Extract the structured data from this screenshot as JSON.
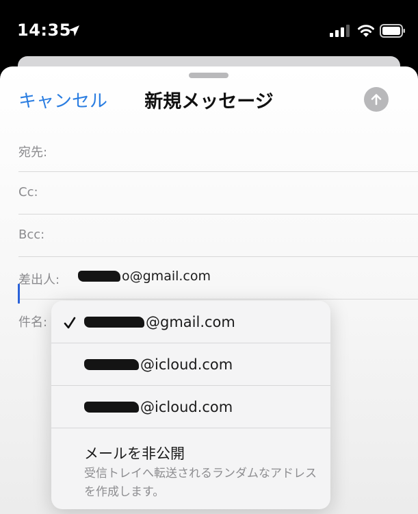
{
  "status_bar": {
    "time": "14:35"
  },
  "compose": {
    "cancel_label": "キャンセル",
    "title": "新規メッセージ",
    "fields": {
      "to_label": "宛先:",
      "cc_label": "Cc:",
      "bcc_label": "Bcc:",
      "from_label": "差出人:",
      "from_value_suffix": "o@gmail.com",
      "subject_label": "件名:"
    }
  },
  "sender_menu": {
    "options": [
      {
        "suffix": "@gmail.com",
        "selected": true
      },
      {
        "suffix": "@icloud.com",
        "selected": false
      },
      {
        "suffix": "@icloud.com",
        "selected": false
      }
    ],
    "hide_my_email": {
      "title": "メールを非公開",
      "description": "受信トレイへ転送されるランダムなアドレスを作成します。"
    }
  },
  "colors": {
    "accent": "#2a7de1",
    "caret": "#2a62d9",
    "send_disabled": "#b8b8ba"
  }
}
